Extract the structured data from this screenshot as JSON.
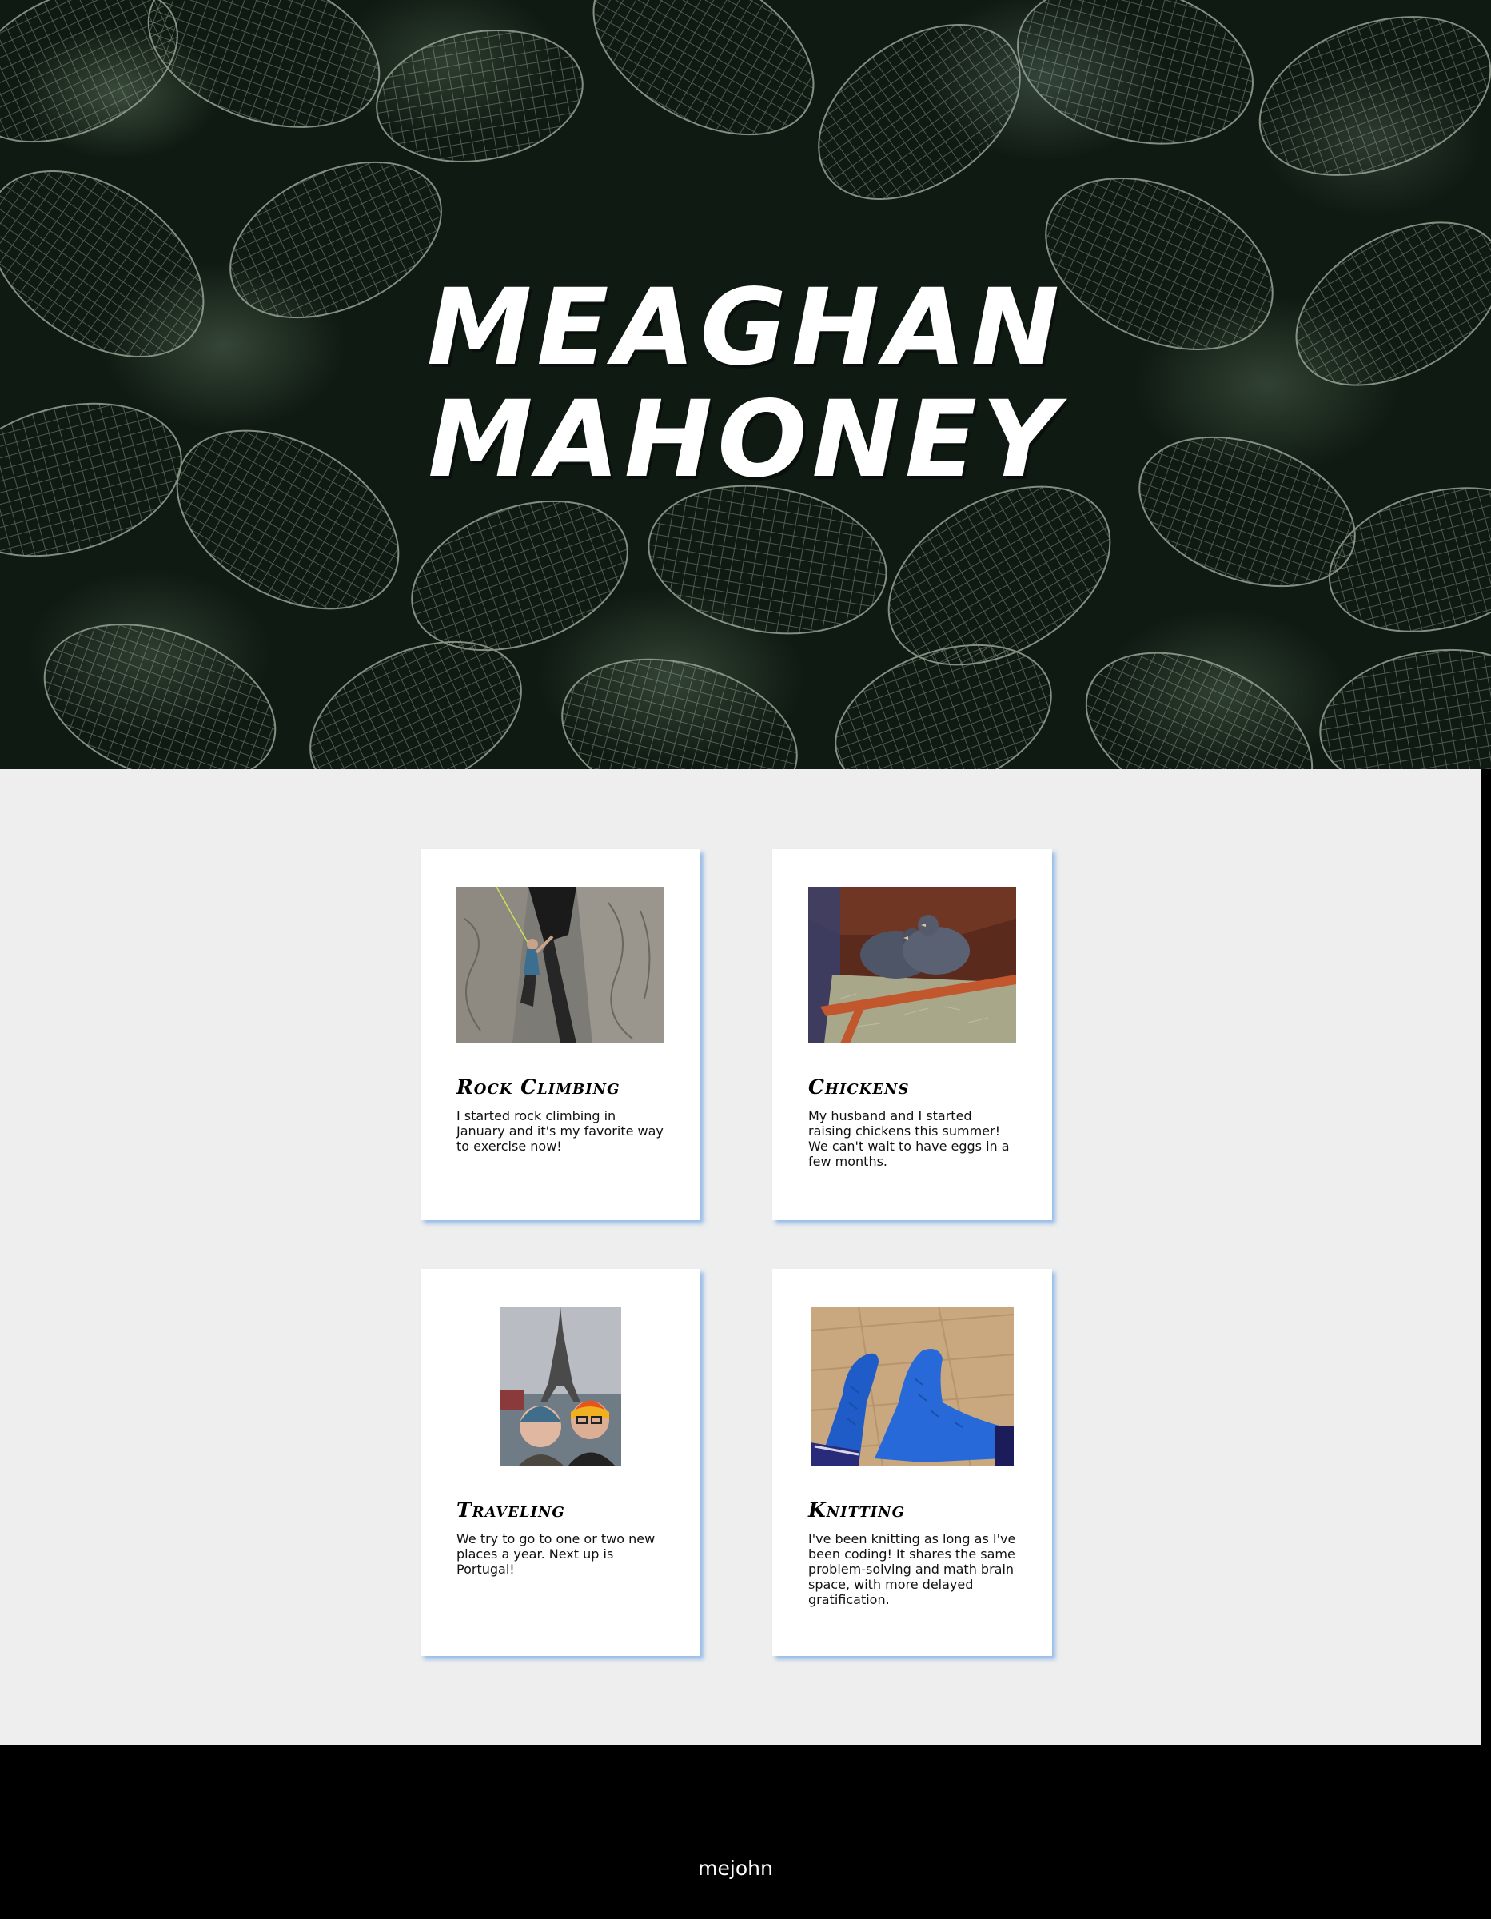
{
  "hero": {
    "title_line1": "MEAGHAN",
    "title_line2": "MAHONEY"
  },
  "cards": [
    {
      "title": "Rock Climbing",
      "text": "I started rock climbing in January and it's my favorite way to exercise now!",
      "image_icon": "rock-climbing-photo"
    },
    {
      "title": "Chickens",
      "text": "My husband and I started raising chickens this summer! We can't wait to have eggs in a few months.",
      "image_icon": "chickens-photo"
    },
    {
      "title": "Traveling",
      "text": "We try to go to one or two new places a year. Next up is Portugal!",
      "image_icon": "eiffel-tower-selfie-photo"
    },
    {
      "title": "Knitting",
      "text": "I've been knitting as long as I've been coding! It shares the same problem-solving and math brain space, with more delayed gratification.",
      "image_icon": "blue-socks-photo"
    }
  ],
  "footer": {
    "text": "mejohn"
  },
  "colors": {
    "main_bg": "#eeeeee",
    "card_shadow": "#78aae6",
    "footer_bg": "#000000"
  }
}
